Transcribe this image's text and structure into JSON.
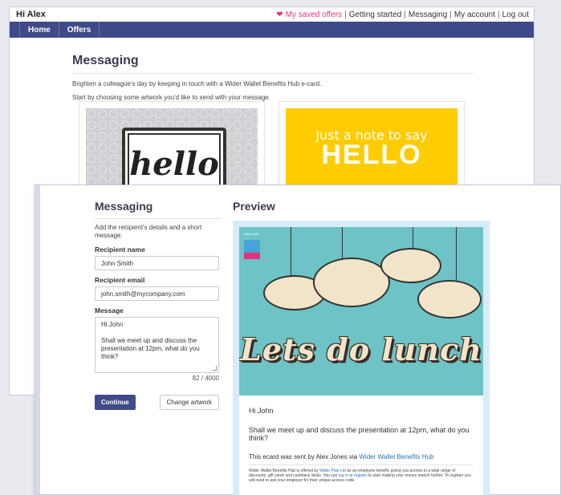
{
  "header": {
    "greeting": "Hi Alex",
    "links": {
      "saved_offers": "My saved offers",
      "getting_started": "Getting started",
      "messaging": "Messaging",
      "my_account": "My account",
      "log_out": "Log out"
    },
    "separator": "|"
  },
  "nav": {
    "items": [
      "Home",
      "Offers"
    ]
  },
  "background_page": {
    "title": "Messaging",
    "intro_1": "Brighten a colleague's day by keeping in touch with a Wider Wallet Benefits Hub e-card.",
    "intro_2": "Start by choosing some artwork you'd like to send with your message.",
    "artwork": [
      {
        "name": "hello frame",
        "text": "hello"
      },
      {
        "name": "yellow hello",
        "line1": "Just a note to say",
        "line2": "HELLO"
      }
    ]
  },
  "form": {
    "title": "Messaging",
    "intro": "Add the recipient's details and a short message.",
    "recipient_name_label": "Recipient name",
    "recipient_name_value": "John Smith",
    "recipient_email_label": "Recipient email",
    "recipient_email_value": "john.smith@mycompany.com",
    "message_label": "Message",
    "message_line_1": "Hi John",
    "message_line_2": "Shall we meet up and discuss the presentation at 12pm, what do you think?",
    "counter": "82 / 4000",
    "continue_label": "Continue",
    "change_artwork_label": "Change artwork"
  },
  "preview": {
    "title": "Preview",
    "badge_text": "Made with",
    "logo_text": "Wider Wallet",
    "card_text": "Lets do lunch",
    "greeting": "Hi John",
    "message": "Shall we meet up and discuss the presentation at 12pm, what do you think?",
    "sent_by_prefix": "This ecard was sent by Alex Jones via ",
    "sent_by_link": "Wider Wallet Benefits Hub",
    "fine_1": "Wider Wallet Benefits Hub is offered by ",
    "fine_link_1": "Wider Plan Ltd",
    "fine_2": " as an employee benefit, giving you access to a wide range of discounts, gift cards and cashback deals. You can ",
    "fine_link_2": "log in",
    "fine_3": " or ",
    "fine_link_3": "register",
    "fine_4": " to start making your money stretch further. To register you will need to ask your employer for their unique access code."
  },
  "colors": {
    "nav_bg": "#3f4a8a",
    "accent_pink": "#e2337a",
    "preview_border": "#d7ecf7",
    "card_teal": "#6dc3c5",
    "link_blue": "#2a72b8"
  }
}
